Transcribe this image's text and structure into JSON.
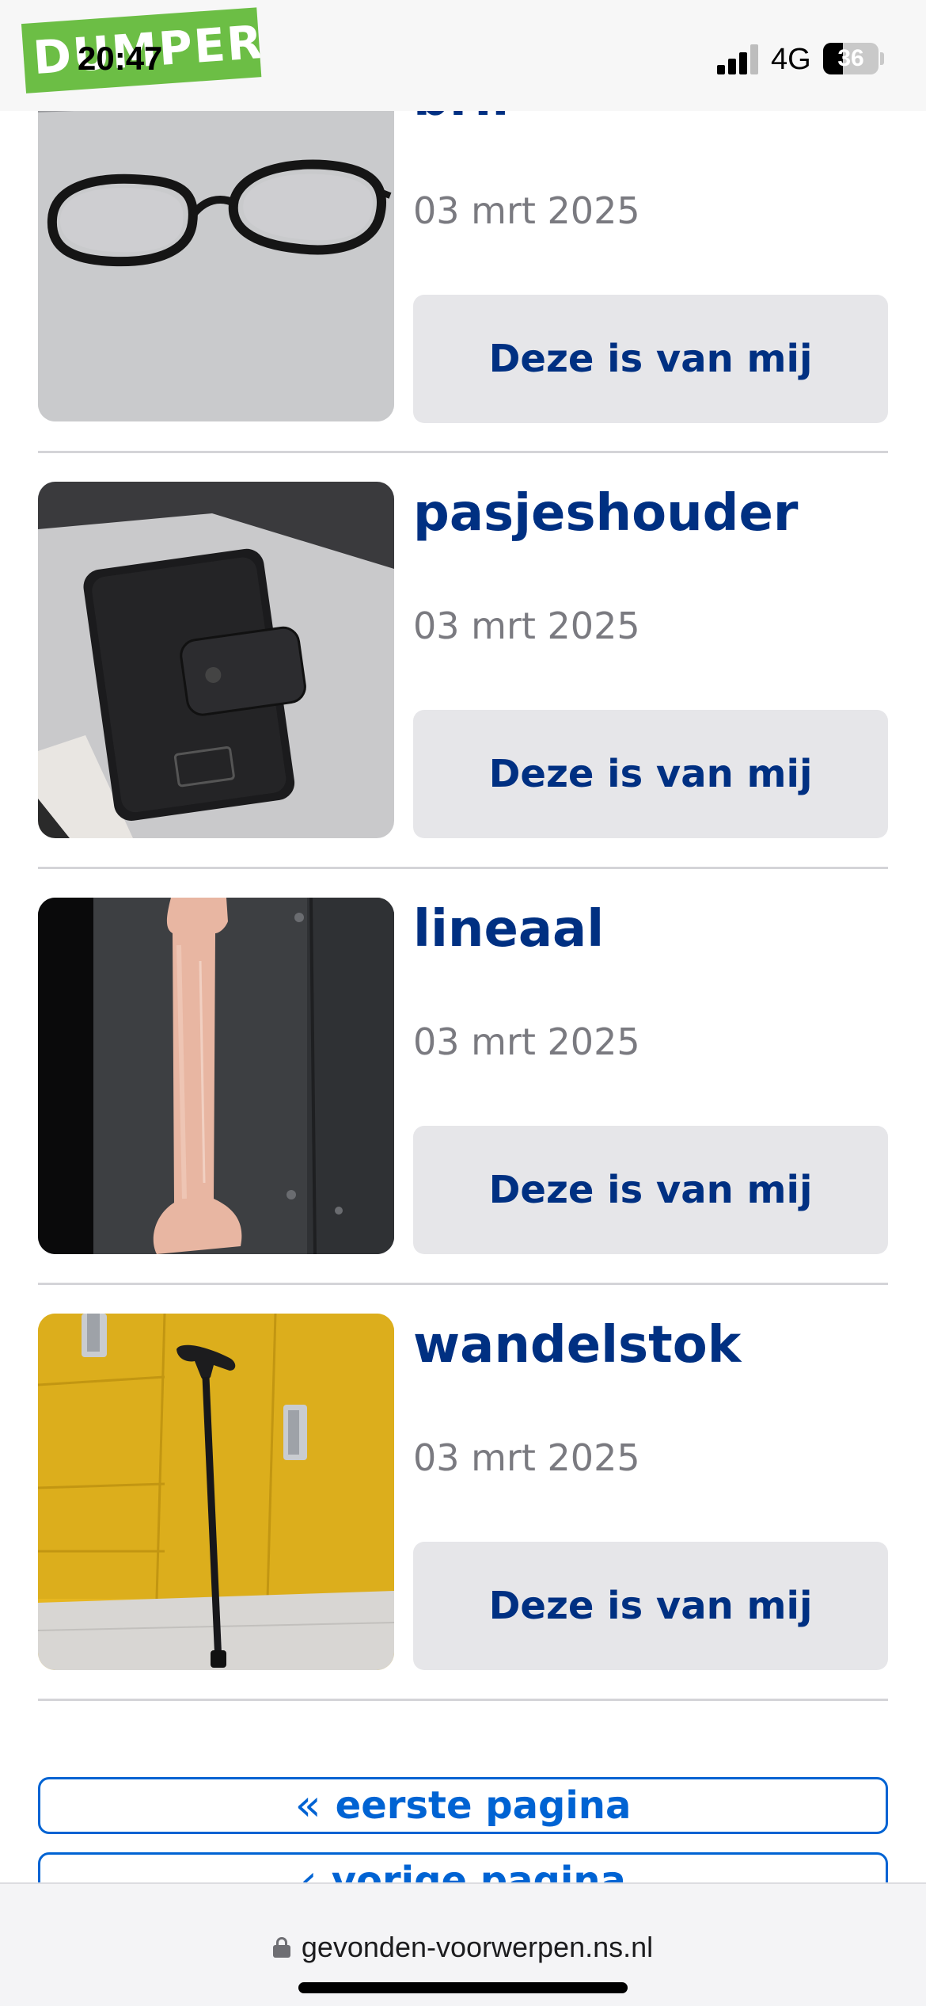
{
  "status_bar": {
    "time": "20:47",
    "network": "4G",
    "battery_percent": "36",
    "battery_level": 0.36,
    "overlay_logo_text": "DUMPERT"
  },
  "items": [
    {
      "title": "bril",
      "date": "03 mrt 2025",
      "claim_label": "Deze is van mij",
      "image": "glasses-photo"
    },
    {
      "title": "pasjeshouder",
      "date": "03 mrt 2025",
      "claim_label": "Deze is van mij",
      "image": "card-holder-photo"
    },
    {
      "title": "lineaal",
      "date": "03 mrt 2025",
      "claim_label": "Deze is van mij",
      "image": "ruler-photo"
    },
    {
      "title": "wandelstok",
      "date": "03 mrt 2025",
      "claim_label": "Deze is van mij",
      "image": "walking-cane-photo"
    }
  ],
  "pagination": {
    "first_label": "eerste pagina",
    "previous_label": "vorige pagina"
  },
  "browser": {
    "url": "gevonden-voorwerpen.ns.nl"
  },
  "colors": {
    "title_blue": "#003082",
    "link_blue": "#0063d3",
    "button_grey": "#e6e6e9",
    "date_grey": "#7a7a80"
  }
}
